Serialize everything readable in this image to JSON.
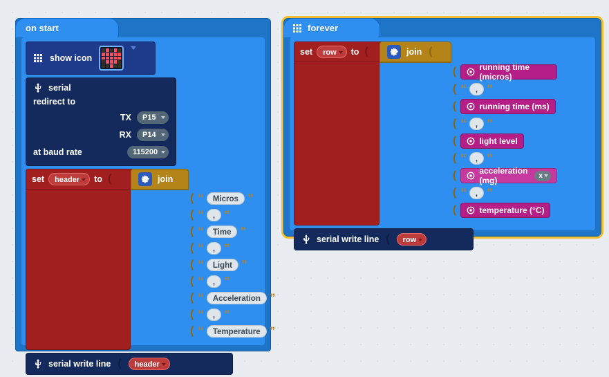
{
  "onstart": {
    "cap": "on start",
    "show_icon_label": "show icon",
    "serial": {
      "lead": "serial",
      "redirect": "redirect to",
      "tx_label": "TX",
      "tx_pin": "P15",
      "rx_label": "RX",
      "rx_pin": "P14",
      "baud_label": "at baud rate",
      "baud_value": "115200"
    },
    "set_label": "set",
    "set_var": "header",
    "set_to": "to",
    "join_label": "join",
    "join_items": [
      "Micros",
      ",",
      "Time",
      ",",
      "Light",
      ",",
      "Acceleration",
      ",",
      "Temperature"
    ],
    "swl_label": "serial write line",
    "swl_arg": "header"
  },
  "forever": {
    "cap": "forever",
    "set_label": "set",
    "set_var": "row",
    "set_to": "to",
    "join_label": "join",
    "reporters": [
      {
        "kind": "reporter",
        "text": "running time (micros)"
      },
      {
        "kind": "str",
        "text": ","
      },
      {
        "kind": "reporter",
        "text": "running time (ms)"
      },
      {
        "kind": "str",
        "text": ","
      },
      {
        "kind": "reporter",
        "text": "light level"
      },
      {
        "kind": "str",
        "text": ","
      },
      {
        "kind": "reporter_axis",
        "text": "acceleration (mg)",
        "axis": "x"
      },
      {
        "kind": "str",
        "text": ","
      },
      {
        "kind": "reporter",
        "text": "temperature (°C)"
      }
    ],
    "swl_label": "serial write line",
    "swl_arg": "row"
  }
}
